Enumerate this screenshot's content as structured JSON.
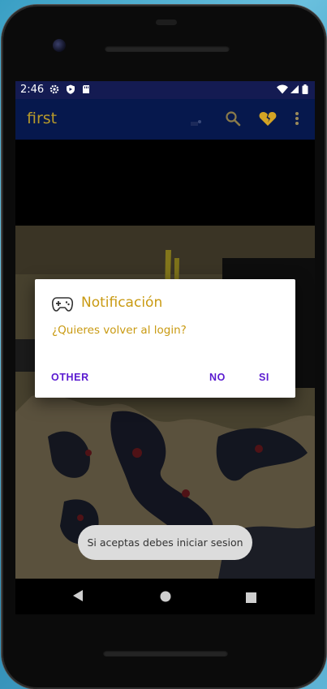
{
  "status_bar": {
    "time": "2:46",
    "icons": [
      "settings-icon",
      "shield-icon",
      "sd-card-icon",
      "wifi-icon",
      "signal-icon",
      "battery-icon"
    ]
  },
  "app_bar": {
    "title": "first",
    "actions": [
      "notification-dot-icon",
      "search-icon",
      "broken-heart-icon",
      "overflow-menu-icon"
    ],
    "accent_color": "#b89a2a",
    "background_color": "#06184d"
  },
  "dialog": {
    "icon": "gamepad-icon",
    "title": "Notificación",
    "message": "¿Quieres volver al login?",
    "buttons": {
      "other": "OTHER",
      "no": "NO",
      "yes": "SI"
    },
    "text_color": "#c99a12",
    "button_color": "#5a1ad0"
  },
  "toast": {
    "text": "Si aceptas debes iniciar sesion"
  },
  "nav_bar": {
    "buttons": [
      "back-icon",
      "home-icon",
      "recents-icon"
    ]
  }
}
